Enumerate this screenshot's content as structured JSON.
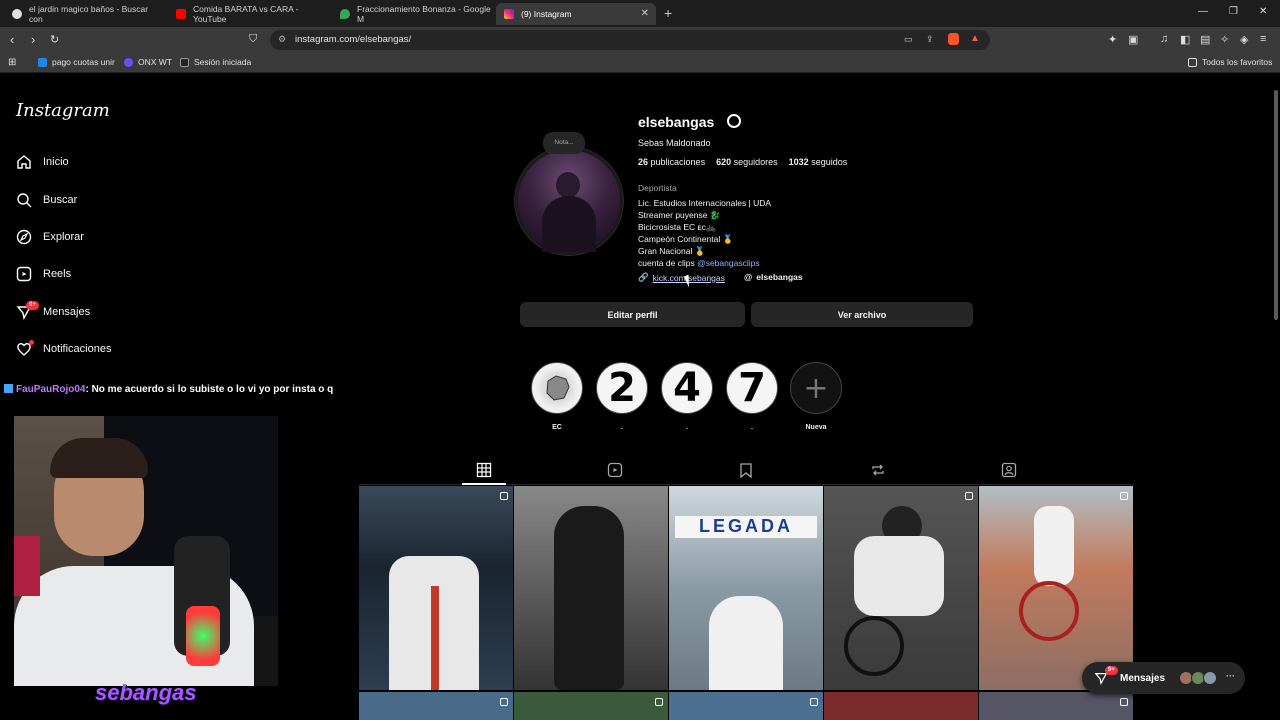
{
  "browser": {
    "tabs": [
      {
        "title": "el jardin magico baños - Buscar con ",
        "color": "#e0e0e0"
      },
      {
        "title": "Comida BARATA vs CARA - YouTube",
        "color": "#ff0000"
      },
      {
        "title": "Fraccionamiento Bonanza - Google M",
        "color": "#34a853"
      },
      {
        "title": "(9) Instagram",
        "color": "#e1306c"
      }
    ],
    "url": "instagram.com/elsebangas/",
    "bookmarks": [
      "pago cuotas unir",
      "ONX WT",
      "Sesión iniciada"
    ],
    "all_favorites": "Todos los favoritos"
  },
  "sidebar": {
    "logo": "Instagram",
    "items": [
      {
        "label": "Inicio",
        "icon": "home-icon"
      },
      {
        "label": "Buscar",
        "icon": "search-icon"
      },
      {
        "label": "Explorar",
        "icon": "explore-icon"
      },
      {
        "label": "Reels",
        "icon": "reels-icon"
      },
      {
        "label": "Mensajes",
        "icon": "messenger-icon"
      },
      {
        "label": "Notificaciones",
        "icon": "heart-icon"
      }
    ],
    "messages_badge": "9+"
  },
  "profile": {
    "note": "Nota...",
    "username": "elsebangas",
    "full_name": "Sebas Maldonado",
    "posts_count": "26",
    "posts_label": "publicaciones",
    "followers_count": "620",
    "followers_label": "seguidores",
    "following_count": "1032",
    "following_label": "seguidos",
    "category": "Deportista",
    "bio_lines": [
      "Lic. Estudios Internacionales | UDA",
      "Streamer puyense 🐉",
      "Bicicrosista EC ᴇᴄ🚲",
      "Campeón Continental 🥇",
      "Gran Nacional 🥇"
    ],
    "clips_prefix": "cuenta de clips ",
    "clips_handle": "@sebangasclips",
    "link": "kick.com/sebangas",
    "threads": "elsebangas",
    "edit_button": "Editar perfil",
    "archive_button": "Ver archivo"
  },
  "highlights": [
    {
      "glyph": "",
      "label": "EC"
    },
    {
      "glyph": "2",
      "label": "."
    },
    {
      "glyph": "4",
      "label": "."
    },
    {
      "glyph": "7",
      "label": "."
    },
    {
      "glyph": "+",
      "label": "Nueva"
    }
  ],
  "chat": {
    "user": "FauPauRojo04",
    "message": ": No me acuerdo si lo subiste o lo vi yo por insta o q"
  },
  "stream": {
    "name": "sebangas"
  },
  "messages_pill": {
    "label": "Mensajes",
    "badge": "9+"
  },
  "colors": {
    "accent_link": "#8fb0ff",
    "badge": "#ff3040",
    "button_bg": "#262626"
  }
}
